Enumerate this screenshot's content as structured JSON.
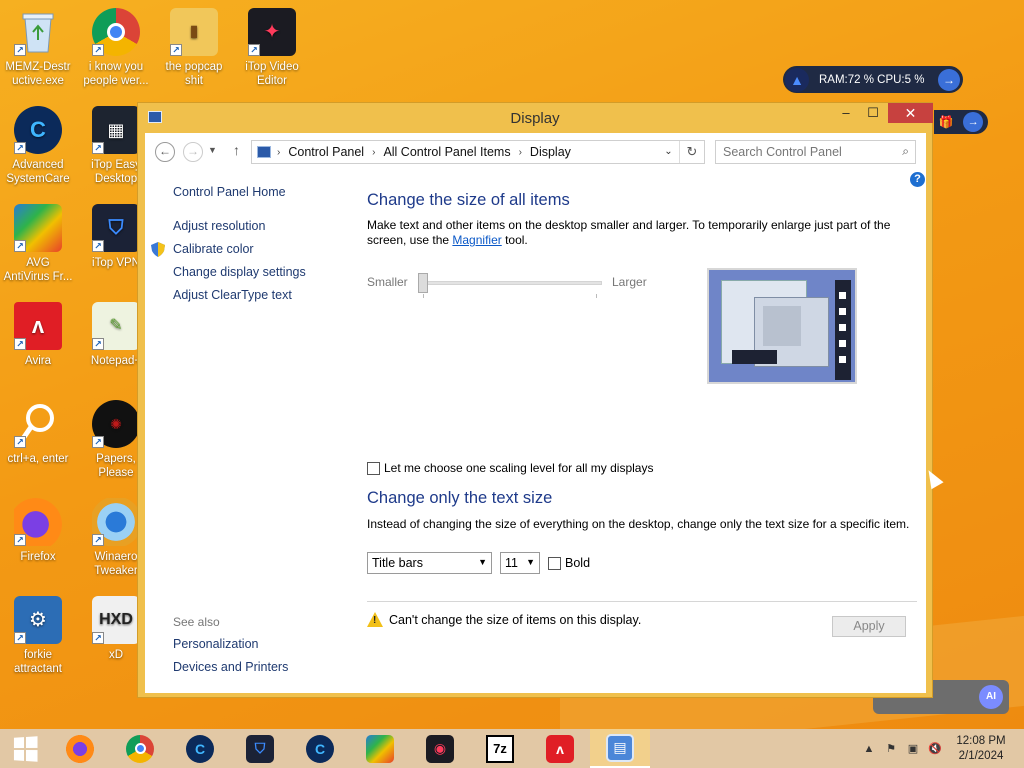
{
  "desktop": {
    "icons": [
      {
        "label": "MEMZ-Destructive.exe",
        "line1": "MEMZ-Destr",
        "line2": "uctive.exe"
      },
      {
        "label": "i know you people wer...",
        "line1": "i know you",
        "line2": "people wer..."
      },
      {
        "label": "the popcap shit",
        "line1": "the popcap",
        "line2": "shit"
      },
      {
        "label": "iTop Video Editor",
        "line1": "iTop Video",
        "line2": "Editor"
      },
      {
        "label": "Advanced SystemCare",
        "line1": "Advanced",
        "line2": "SystemCare"
      },
      {
        "label": "iTop Easy Desktop",
        "line1": "iTop Easy",
        "line2": "Desktop"
      },
      {
        "label": "AVG AntiVirus Fr...",
        "line1": "AVG",
        "line2": "AntiVirus Fr..."
      },
      {
        "label": "iTop VPN",
        "line1": "iTop VPN",
        "line2": ""
      },
      {
        "label": "Avira",
        "line1": "Avira",
        "line2": ""
      },
      {
        "label": "Notepad++",
        "line1": "Notepad+",
        "line2": ""
      },
      {
        "label": "ctrl+a, enter",
        "line1": "ctrl+a, enter",
        "line2": ""
      },
      {
        "label": "Papers, Please",
        "line1": "Papers,",
        "line2": "Please"
      },
      {
        "label": "Firefox",
        "line1": "Firefox",
        "line2": ""
      },
      {
        "label": "Winaero Tweaker",
        "line1": "Winaero",
        "line2": "Tweaker"
      },
      {
        "label": "forkie attractant",
        "line1": "forkie",
        "line2": "attractant"
      },
      {
        "label": "xD",
        "line1": "xD",
        "line2": ""
      }
    ]
  },
  "gadget": {
    "text": "RAM:72 %  CPU:5 %"
  },
  "window": {
    "title": "Display",
    "minimize": "–",
    "maximize": "☐",
    "close": "✕"
  },
  "address": {
    "crumbs": [
      "Control Panel",
      "All Control Panel Items",
      "Display"
    ],
    "search_placeholder": "Search Control Panel"
  },
  "leftnav": {
    "home": "Control Panel Home",
    "links": [
      "Adjust resolution",
      "Calibrate color",
      "Change display settings",
      "Adjust ClearType text"
    ],
    "see_also_heading": "See also",
    "see_also": [
      "Personalization",
      "Devices and Printers"
    ]
  },
  "main": {
    "heading1": "Change the size of all items",
    "desc1_pre": "Make text and other items on the desktop smaller and larger. To temporarily enlarge just part of the screen, use the ",
    "desc1_link": "Magnifier",
    "desc1_post": " tool.",
    "slider_min_label": "Smaller",
    "slider_max_label": "Larger",
    "slider_value": 0,
    "checkbox_label": "Let me choose one scaling level for all my displays",
    "heading2": "Change only the text size",
    "desc2": "Instead of changing the size of everything on the desktop, change only the text size for a specific item.",
    "item_select": "Title bars",
    "size_select": "11",
    "bold_label": "Bold",
    "warning": "Can't change the size of items on this display.",
    "apply": "Apply"
  },
  "taskbar": {
    "clock_time": "12:08 PM",
    "clock_date": "2/1/2024",
    "apps": [
      "Firefox",
      "Chrome",
      "Advanced SystemCare",
      "iTop VPN",
      "Advanced SystemCare",
      "AVG",
      "iTop Screen Recorder",
      "7-Zip",
      "Avira",
      "Control Panel"
    ],
    "sevenzip": "7z"
  },
  "colors": {
    "window_frame": "#f0c04c",
    "heading": "#1e3a8a",
    "link": "#1f3a70",
    "close_button": "#c7413f",
    "desktop": "#f39a14"
  }
}
